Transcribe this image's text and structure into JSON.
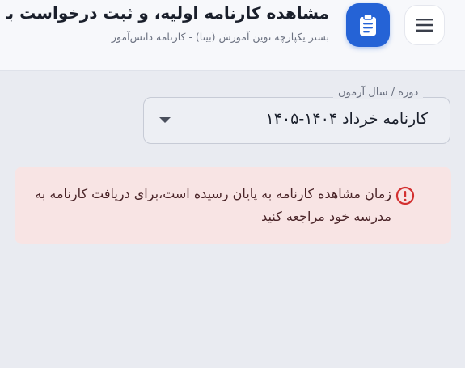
{
  "header": {
    "title": "مشاهده کارنامه اولیه، و ثبت درخواست بر...",
    "subtitle": "بستر یکپارچه نوین آموزش (بینا) - کارنامه دانش‌آموز",
    "menu_icon": "hamburger-menu-icon",
    "app_icon": "clipboard-icon",
    "accent_color": "#2563d6"
  },
  "exam_select": {
    "label": "دوره / سال آزمون",
    "value": "کارنامه خرداد ۱۴۰۴-۱۴۰۵"
  },
  "alert": {
    "icon": "error-circle-icon",
    "message": "زمان مشاهده کارنامه به پایان رسیده است،برای دریافت کارنامه به مدرسه خود مراجعه کنید",
    "color": "#d32f2f"
  }
}
